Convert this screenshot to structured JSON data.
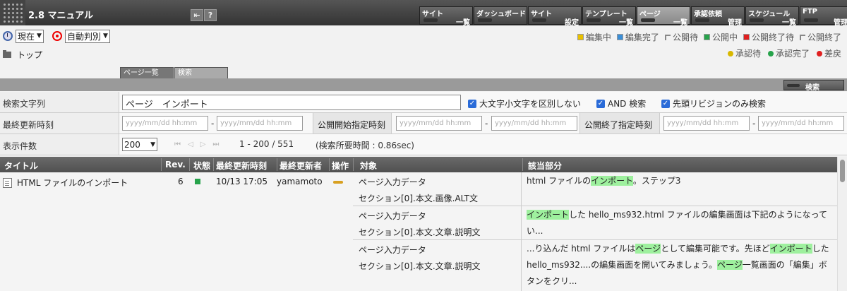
{
  "app": {
    "title": "2.8 マニュアル"
  },
  "nav": [
    {
      "top": "サイト",
      "bottom": "一覧",
      "active": false
    },
    {
      "top": "ダッシュボード",
      "bottom": "",
      "active": false
    },
    {
      "top": "サイト",
      "bottom": "設定",
      "active": false
    },
    {
      "top": "テンプレート",
      "bottom": "一覧",
      "active": false
    },
    {
      "top": "ページ",
      "bottom": "一覧",
      "active": true
    },
    {
      "top": "承認依頼",
      "bottom": "管理",
      "active": false
    },
    {
      "top": "スケジュール",
      "bottom": "一覧",
      "active": false
    },
    {
      "top": "FTP",
      "bottom": "管理",
      "active": false
    }
  ],
  "toolbar": {
    "time_select": "現在",
    "mode_select": "自動判別"
  },
  "legend_status": [
    {
      "label": "編集中",
      "color": "#e8c000"
    },
    {
      "label": "編集完了",
      "color": "#3a8fd8"
    },
    {
      "label": "公開待",
      "color": "corner"
    },
    {
      "label": "公開中",
      "color": "#27a34b"
    },
    {
      "label": "公開終了待",
      "color": "#e02020"
    },
    {
      "label": "公開終了",
      "color": "corner"
    }
  ],
  "legend_approval": [
    {
      "label": "承認待",
      "color": "#d8b800"
    },
    {
      "label": "承認完了",
      "color": "#27a34b"
    },
    {
      "label": "差戻",
      "color": "#e02020"
    }
  ],
  "breadcrumb": {
    "label": "トップ"
  },
  "tabs": [
    "ページ一覧",
    "検索"
  ],
  "search_button": "検索",
  "form": {
    "keyword_label": "検索文字列",
    "keyword_value": "ページ　インポート",
    "opt_case": "大文字小文字を区別しない",
    "opt_and": "AND 検索",
    "opt_head": "先頭リビジョンのみ検索",
    "updated_label": "最終更新時刻",
    "date_placeholder": "yyyy/mm/dd hh:mm",
    "pub_start_label": "公開開始指定時刻",
    "pub_end_label": "公開終了指定時刻",
    "count_label": "表示件数",
    "count_value": "200",
    "range": "1 - 200  /  551",
    "elapsed": "(検索所要時間 : 0.86sec)"
  },
  "table": {
    "headers": [
      "タイトル",
      "Rev.",
      "状態",
      "最終更新時刻",
      "最終更新者",
      "操作",
      "対象",
      "該当部分"
    ],
    "row": {
      "title": "HTML ファイルのインポート",
      "rev": "6",
      "updated": "10/13 17:05",
      "user": "yamamoto"
    },
    "matches": [
      {
        "target1": "ページ入力データ",
        "target2": "セクション[0].本文.画像.ALT文",
        "parts": [
          {
            "t": "html ファイルの"
          },
          {
            "t": "インポート",
            "hl": true
          },
          {
            "t": "。ステップ3"
          }
        ]
      },
      {
        "target1": "ページ入力データ",
        "target2": "セクション[0].本文.文章.説明文",
        "parts": [
          {
            "t": "インポート",
            "hl": true
          },
          {
            "t": "した hello_ms932.html ファイルの編集画面は下記のようになってい..."
          }
        ]
      },
      {
        "target1": "ページ入力データ",
        "target2": "セクション[0].本文.文章.説明文",
        "parts": [
          {
            "t": "...り込んだ html ファイルは"
          },
          {
            "t": "ページ",
            "hl": true
          },
          {
            "t": "として編集可能です。先ほど"
          },
          {
            "t": "インポート",
            "hl": true
          },
          {
            "t": "した hello_ms932....の編集画面を開いてみましょう。"
          },
          {
            "t": "ページ",
            "hl": true
          },
          {
            "t": "一覧画面の「編集」ボタンをクリ..."
          }
        ]
      }
    ]
  }
}
